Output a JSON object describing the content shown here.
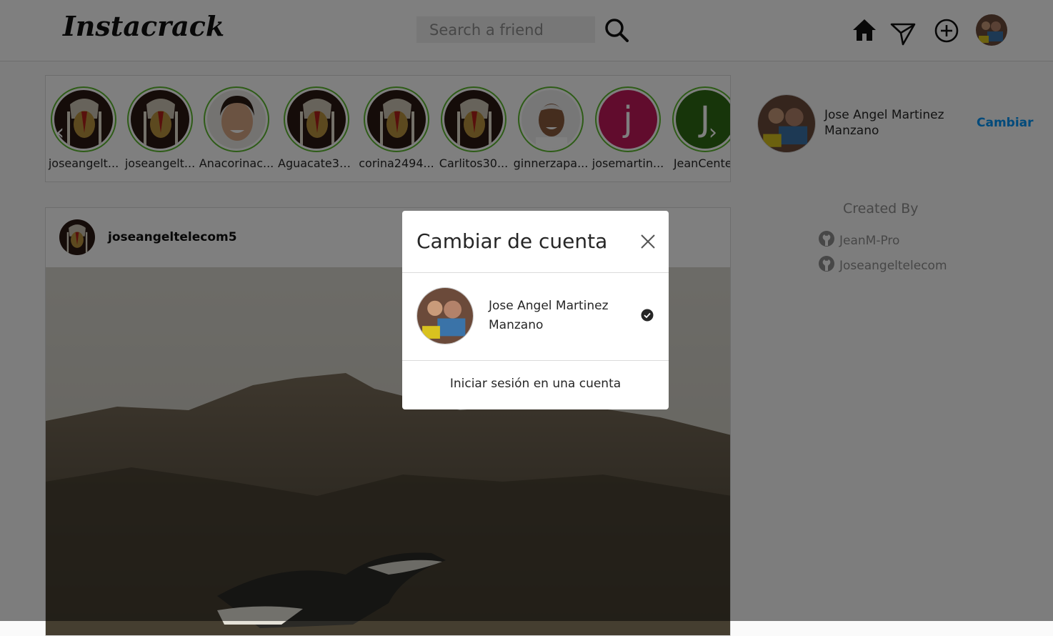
{
  "app": {
    "title": "Instacrack"
  },
  "header": {
    "search_placeholder": "Search a friend",
    "icons": [
      "search-icon",
      "home-icon",
      "direct-message-icon",
      "new-post-icon",
      "profile-avatar"
    ]
  },
  "stories": {
    "items": [
      {
        "label": "joseangelt..."
      },
      {
        "label": "joseangelt..."
      },
      {
        "label": "Anacorinac..."
      },
      {
        "label": "Aguacate30..."
      },
      {
        "label": "corina2494..."
      },
      {
        "label": "Carlitos30..."
      },
      {
        "label": "ginnerzapa..."
      },
      {
        "label": "josemartin...",
        "letter": "j"
      },
      {
        "label": "JeanCenter",
        "letter": "J"
      }
    ]
  },
  "post": {
    "username": "joseangeltelecom5"
  },
  "sidebar": {
    "user_name": "Jose Angel Martinez Manzano",
    "switch_label": "Cambiar",
    "created_by_title": "Created By",
    "credits": [
      {
        "name": "JeanM-Pro"
      },
      {
        "name": "Joseangeltelecom"
      }
    ]
  },
  "modal": {
    "title": "Cambiar de cuenta",
    "account_name": "Jose Angel Martinez Manzano",
    "login_label": "Iniciar sesión en una cuenta"
  },
  "colors": {
    "story_ring": "#5cb82e",
    "accent": "#0095f6",
    "letter_pink": "#c2185b",
    "letter_green": "#2e6b15"
  }
}
